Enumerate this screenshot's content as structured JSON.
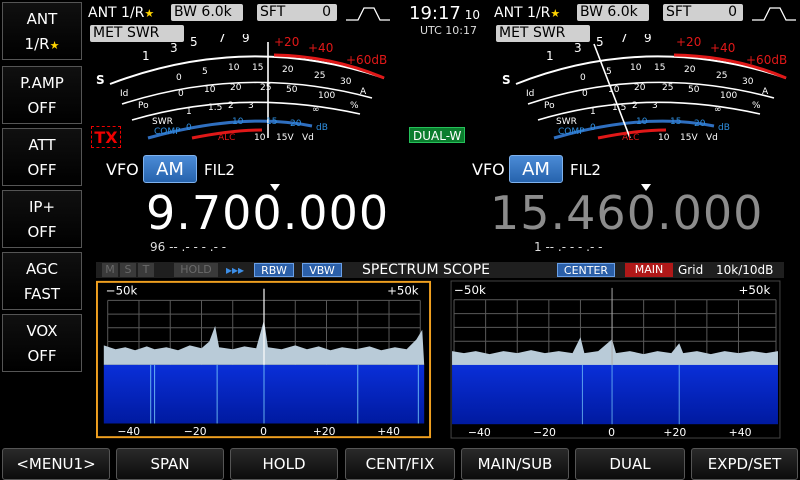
{
  "sidebar": {
    "items": [
      {
        "l1": "ANT",
        "l2": "1/R",
        "star": "★"
      },
      {
        "l1": "P.AMP",
        "l2": "OFF"
      },
      {
        "l1": "ATT",
        "l2": "OFF"
      },
      {
        "l1": "IP+",
        "l2": "OFF"
      },
      {
        "l1": "AGC",
        "l2": "FAST"
      },
      {
        "l1": "VOX",
        "l2": "OFF"
      }
    ]
  },
  "main_status": {
    "ant": "ANT 1/R",
    "star": "★",
    "bw_label": "BW",
    "bw_value": "6.0k",
    "sft_label": "SFT",
    "sft_value": "0",
    "met_label": "MET",
    "met_value": "SWR"
  },
  "sub_status": {
    "ant": "ANT 1/R",
    "star": "★",
    "bw_label": "BW",
    "bw_value": "6.0k",
    "sft_label": "SFT",
    "sft_value": "0",
    "met_label": "MET",
    "met_value": "SWR"
  },
  "clock": {
    "time": "19:17",
    "seconds": "10",
    "utc": "UTC 10:17"
  },
  "meter_labels": {
    "s_scale": [
      "S",
      "1",
      "3",
      "5",
      "7",
      "9",
      "+20",
      "+40",
      "+60dB"
    ],
    "po_scale": [
      "Po",
      "0",
      "10",
      "20",
      "25",
      "50",
      "100",
      "%"
    ],
    "id_scale": [
      "Id",
      "0",
      "5",
      "10",
      "15",
      "20",
      "25",
      "30",
      "A"
    ],
    "swr_scale": [
      "SWR",
      "1",
      "1.5",
      "2",
      "3",
      "∞"
    ],
    "comp_scale": [
      "COMP",
      "0",
      "10",
      "15",
      "20",
      "dB"
    ],
    "alc_label": "ALC",
    "vd_scale": [
      "10",
      "15V",
      "Vd"
    ]
  },
  "badges": {
    "tx": "TX",
    "dualw": "DUAL-W"
  },
  "vfo_main": {
    "label": "VFO",
    "mode": "AM",
    "filter": "FIL2",
    "frequency": "9.700.000",
    "memo": "96  -- .- - - .- -"
  },
  "vfo_sub": {
    "label": "VFO",
    "mode": "AM",
    "filter": "FIL2",
    "frequency": "15.460.000",
    "memo": "1  -- .- - - .- -"
  },
  "scope": {
    "chips": [
      "M",
      "S",
      "T",
      "HOLD"
    ],
    "arrows": "▸▸▸",
    "rbw": "RBW",
    "vbw": "VBW",
    "title": "SPECTRUM SCOPE",
    "center": "CENTER",
    "main": "MAIN",
    "grid": "Grid",
    "scale": "10k/10dB",
    "left_panel": {
      "span_left": "−50k",
      "span_right": "+50k",
      "ticks": [
        "−40",
        "−20",
        "0",
        "+20",
        "+40"
      ]
    },
    "right_panel": {
      "span_left": "−50k",
      "span_right": "+50k",
      "ticks": [
        "−40",
        "−20",
        "0",
        "+20",
        "+40"
      ]
    }
  },
  "bottom_buttons": [
    "<MENU1>",
    "SPAN",
    "HOLD",
    "CENT/FIX",
    "MAIN/SUB",
    "DUAL",
    "EXPD/SET"
  ],
  "colors": {
    "accent_blue": "#2f6fc0",
    "red_scale": "#e01818",
    "scope_highlight": "#f0a020",
    "waterfall": "#0020b0"
  }
}
